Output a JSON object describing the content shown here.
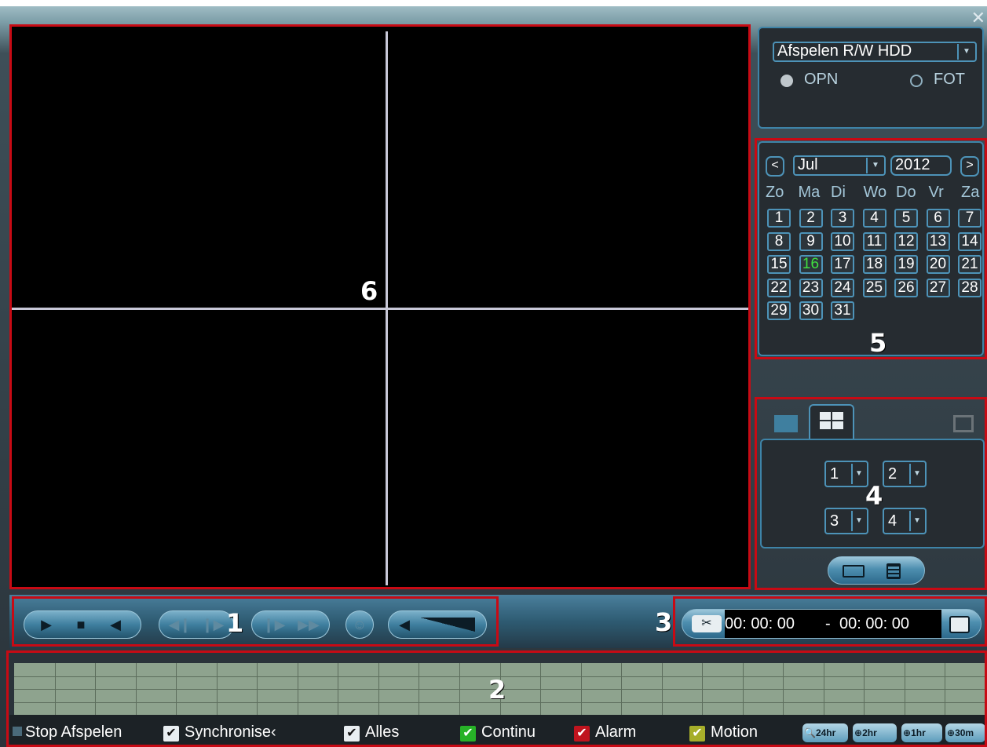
{
  "window": {
    "close_glyph": "✕"
  },
  "annotations": {
    "n1": "1",
    "n2": "2",
    "n3": "3",
    "n4": "4",
    "n5": "5",
    "n6": "6"
  },
  "search": {
    "source_value": "Afspelen R/W HDD",
    "radio_record_label": "OPN",
    "radio_record_selected": true,
    "radio_photo_label": "FOT",
    "radio_photo_selected": false
  },
  "calendar": {
    "prev_label": "<",
    "next_label": ">",
    "month": "Jul",
    "year": "2012",
    "weekdays": [
      "Zo",
      "Ma",
      "Di",
      "Wo",
      "Do",
      "Vr",
      "Za"
    ],
    "days": [
      "1",
      "2",
      "3",
      "4",
      "5",
      "6",
      "7",
      "8",
      "9",
      "10",
      "11",
      "12",
      "13",
      "14",
      "15",
      "16",
      "17",
      "18",
      "19",
      "20",
      "21",
      "22",
      "23",
      "24",
      "25",
      "26",
      "27",
      "28",
      "29",
      "30",
      "31"
    ],
    "today": "16"
  },
  "layout_panel": {
    "channels": [
      "1",
      "2",
      "3",
      "4"
    ],
    "icons": [
      "single-view-icon",
      "quad-view-icon",
      "fullscreen-icon",
      "search-file-icon",
      "file-list-icon"
    ]
  },
  "playback": {
    "icons": [
      "play-icon",
      "stop-icon",
      "reverse-play-icon",
      "prev-frame-icon",
      "next-frame-icon",
      "slow-icon",
      "fast-icon",
      "smart-search-icon",
      "volume-icon"
    ]
  },
  "clip": {
    "start_time": "00: 00: 00",
    "separator": "-",
    "end_time": "00: 00: 00"
  },
  "timeline": {
    "stop_label": "Stop Afspelen",
    "sync_label": "Synchronise‹",
    "all_label": "Alles",
    "continuous_label": "Continu",
    "alarm_label": "Alarm",
    "motion_label": "Motion",
    "colors": {
      "continuous": "#27b227",
      "alarm": "#c0141e",
      "motion": "#a6ae2a"
    },
    "zoom": [
      "24hr",
      "2hr",
      "1hr",
      "30m"
    ]
  }
}
